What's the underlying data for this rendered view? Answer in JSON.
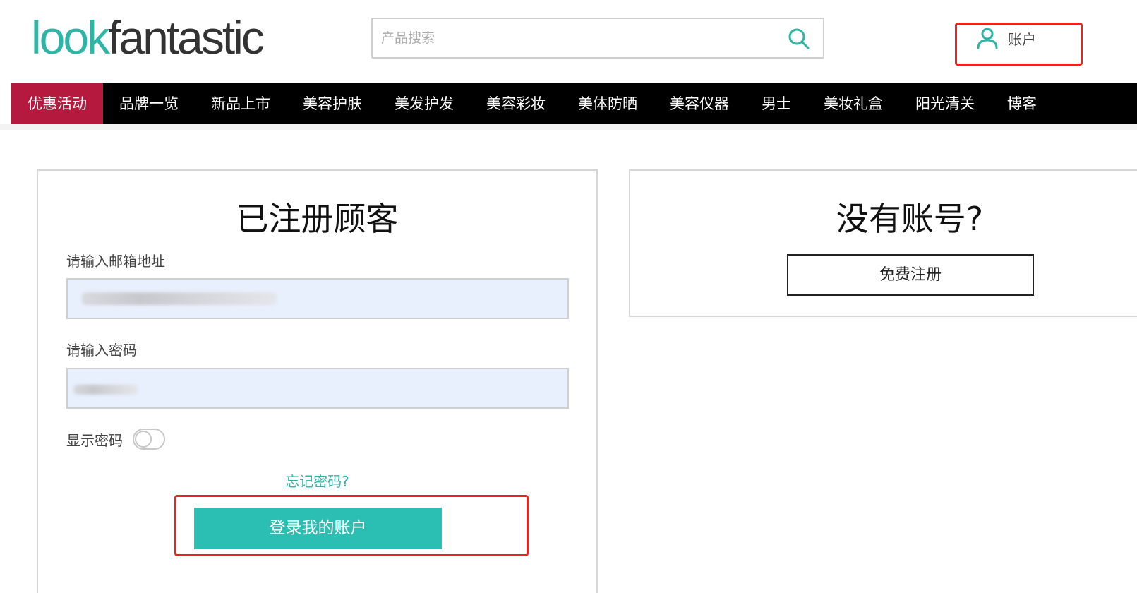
{
  "header": {
    "logo_part1": "look",
    "logo_part2": "fantastic",
    "search_placeholder": "产品搜索",
    "account_label": "账户"
  },
  "nav": {
    "items": [
      {
        "label": "优惠活动",
        "active": true
      },
      {
        "label": "品牌一览"
      },
      {
        "label": "新品上市"
      },
      {
        "label": "美容护肤"
      },
      {
        "label": "美发护发"
      },
      {
        "label": "美容彩妆"
      },
      {
        "label": "美体防晒"
      },
      {
        "label": "美容仪器"
      },
      {
        "label": "男士"
      },
      {
        "label": "美妆礼盒"
      },
      {
        "label": "阳光清关"
      },
      {
        "label": "博客"
      }
    ]
  },
  "login": {
    "title": "已注册顾客",
    "email_label": "请输入邮箱地址",
    "password_label": "请输入密码",
    "show_password_label": "显示密码",
    "forgot_label": "忘记密码?",
    "submit_label": "登录我的账户"
  },
  "register": {
    "title": "没有账号?",
    "button_label": "免费注册"
  },
  "colors": {
    "brand_teal": "#2fb5a6",
    "button_teal": "#2bbfb4",
    "nav_active": "#b51a3e",
    "highlight_red": "#e8261f"
  }
}
